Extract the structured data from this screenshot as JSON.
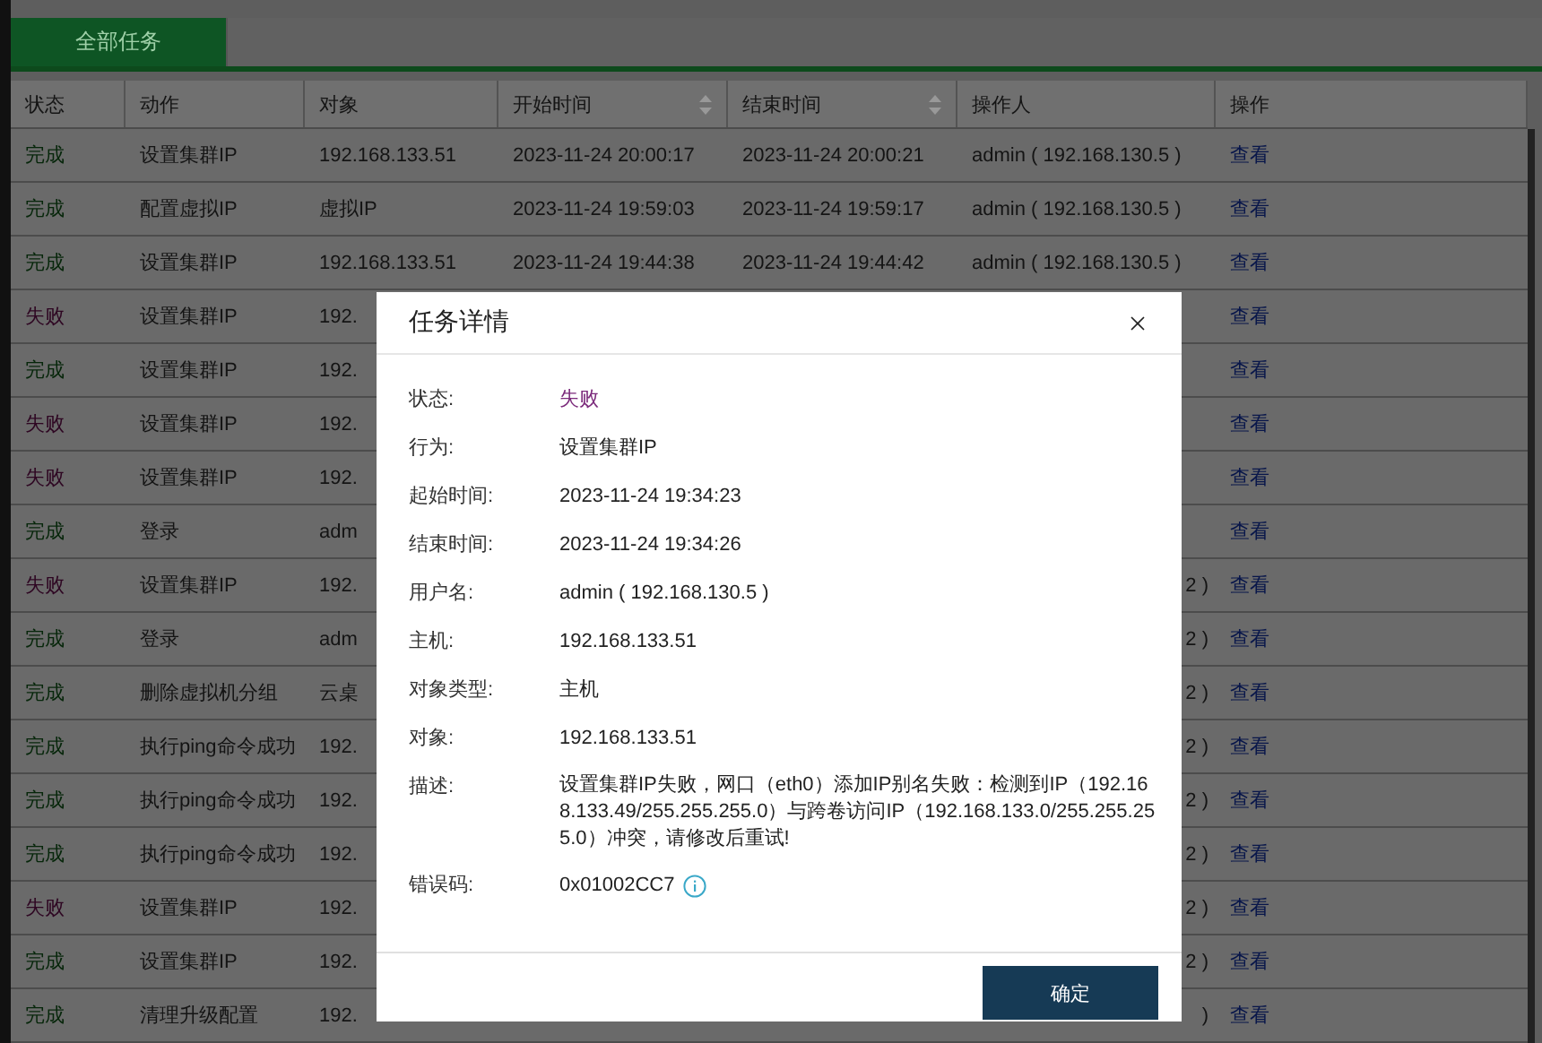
{
  "tabs": [
    {
      "label": "全部任务",
      "selected": true
    }
  ],
  "table": {
    "columns": [
      {
        "label": "状态",
        "sortable": false
      },
      {
        "label": "动作",
        "sortable": false
      },
      {
        "label": "对象",
        "sortable": false
      },
      {
        "label": "开始时间",
        "sortable": true
      },
      {
        "label": "结束时间",
        "sortable": true
      },
      {
        "label": "操作人",
        "sortable": false
      },
      {
        "label": "操作",
        "sortable": false
      }
    ],
    "rows": [
      {
        "status": "完成",
        "color": "#06260a",
        "action": "设置集群IP",
        "object": "192.168.133.51",
        "start": "2023-11-24 20:00:17",
        "end": "2023-11-24 20:00:21",
        "operator": "admin ( 192.168.130.5 )",
        "link": "查看"
      },
      {
        "status": "完成",
        "color": "#06260a",
        "action": "配置虚拟IP",
        "object": "虚拟IP",
        "start": "2023-11-24 19:59:03",
        "end": "2023-11-24 19:59:17",
        "operator": "admin ( 192.168.130.5 )",
        "link": "查看"
      },
      {
        "status": "完成",
        "color": "#06260a",
        "action": "设置集群IP",
        "object": "192.168.133.51",
        "start": "2023-11-24 19:44:38",
        "end": "2023-11-24 19:44:42",
        "operator": "admin ( 192.168.130.5 )",
        "link": "查看"
      },
      {
        "status": "失败",
        "color": "#2e0622",
        "action": "设置集群IP",
        "object": "192.",
        "link": "查看"
      },
      {
        "status": "完成",
        "color": "#06260a",
        "action": "设置集群IP",
        "object": "192.",
        "link": "查看"
      },
      {
        "status": "失败",
        "color": "#2e0622",
        "action": "设置集群IP",
        "object": "192.",
        "link": "查看"
      },
      {
        "status": "失败",
        "color": "#2e0622",
        "action": "设置集群IP",
        "object": "192.",
        "link": "查看"
      },
      {
        "status": "完成",
        "color": "#06260a",
        "action": "登录",
        "object": "adm",
        "link": "查看"
      },
      {
        "status": "失败",
        "color": "#2e0622",
        "action": "设置集群IP",
        "object": "192.",
        "operator_tail": "2 )",
        "link": "查看"
      },
      {
        "status": "完成",
        "color": "#06260a",
        "action": "登录",
        "object": "adm",
        "operator_tail": "2 )",
        "link": "查看"
      },
      {
        "status": "完成",
        "color": "#06260a",
        "action": "删除虚拟机分组",
        "object": "云桌",
        "operator_tail": "2 )",
        "link": "查看"
      },
      {
        "status": "完成",
        "color": "#06260a",
        "action": "执行ping命令成功",
        "object": "192.",
        "operator_tail": "2 )",
        "link": "查看"
      },
      {
        "status": "完成",
        "color": "#06260a",
        "action": "执行ping命令成功",
        "object": "192.",
        "operator_tail": "2 )",
        "link": "查看"
      },
      {
        "status": "完成",
        "color": "#06260a",
        "action": "执行ping命令成功",
        "object": "192.",
        "operator_tail": "2 )",
        "link": "查看"
      },
      {
        "status": "失败",
        "color": "#2e0622",
        "action": "设置集群IP",
        "object": "192.",
        "operator_tail": "2 )",
        "link": "查看"
      },
      {
        "status": "完成",
        "color": "#06260a",
        "action": "设置集群IP",
        "object": "192.",
        "operator_tail": "2 )",
        "link": "查看"
      },
      {
        "status": "完成",
        "color": "#06260a",
        "action": "清理升级配置",
        "object": "192.",
        "operator_tail": ")",
        "link": "查看"
      }
    ]
  },
  "dialog": {
    "title": "任务详情",
    "fields": [
      {
        "label": "状态:",
        "value": "失败",
        "color": "#7b2a7b"
      },
      {
        "label": "行为:",
        "value": "设置集群IP"
      },
      {
        "label": "起始时间:",
        "value": "2023-11-24 19:34:23"
      },
      {
        "label": "结束时间:",
        "value": "2023-11-24 19:34:26"
      },
      {
        "label": "用户名:",
        "value": "admin ( 192.168.130.5 )"
      },
      {
        "label": "主机:",
        "value": "192.168.133.51"
      },
      {
        "label": "对象类型:",
        "value": "主机"
      },
      {
        "label": "对象:",
        "value": "192.168.133.51"
      },
      {
        "label": "描述:",
        "value": "设置集群IP失败，网口（eth0）添加IP别名失败：检测到IP（192.168.133.49/255.255.255.0）与跨卷访问IP（192.168.133.0/255.255.255.0）冲突，请修改后重试!"
      },
      {
        "label": "错误码:",
        "value": "0x01002CC7",
        "kind": "code"
      }
    ],
    "button": "确定"
  }
}
